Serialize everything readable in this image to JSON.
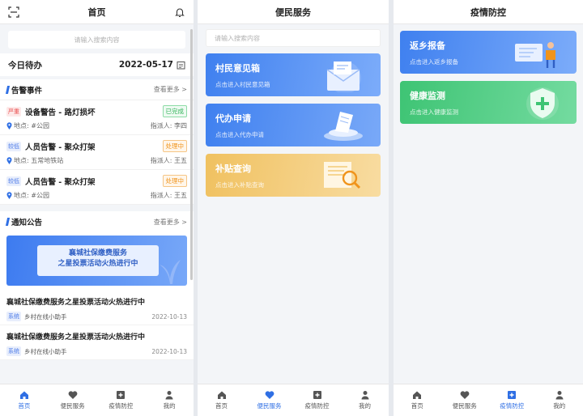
{
  "home": {
    "title": "首页",
    "search_placeholder": "请输入搜索内容",
    "todo_title": "今日待办",
    "todo_date": "2022-05-17",
    "alarm_section": {
      "title": "告警事件",
      "more": "查看更多 >"
    },
    "alarms": [
      {
        "level": "严重",
        "level_type": "high",
        "name": "设备警告 - 路灯损坏",
        "status": "已完成",
        "status_type": "done",
        "location": "地点: #公园",
        "assignee": "指派人: 李四"
      },
      {
        "level": "较低",
        "level_type": "low",
        "name": "人员告警 - 聚众打架",
        "status": "处理中",
        "status_type": "doing",
        "location": "地点: 五常地铁站",
        "assignee": "指派人: 王五"
      },
      {
        "level": "较低",
        "level_type": "low",
        "name": "人员告警 - 聚众打架",
        "status": "处理中",
        "status_type": "doing",
        "location": "地点: #公园",
        "assignee": "指派人: 王五"
      }
    ],
    "notice_section": {
      "title": "通知公告",
      "more": "查看更多 >"
    },
    "banner": {
      "line1": "襄城社保缴费服务",
      "line2": "之星投票活动火热进行中"
    },
    "news": [
      {
        "title": "襄城社保缴费服务之星投票活动火热进行中",
        "tag": "系统",
        "source": "乡村在线小助手",
        "date": "2022-10-13"
      },
      {
        "title": "襄城社保缴费服务之星投票活动火热进行中",
        "tag": "系统",
        "source": "乡村在线小助手",
        "date": "2022-10-13"
      }
    ]
  },
  "service": {
    "title": "便民服务",
    "search_placeholder": "请输入搜索内容",
    "cards": [
      {
        "title": "村民意见箱",
        "subtitle": "点击进入村民意见箱"
      },
      {
        "title": "代办申请",
        "subtitle": "点击进入代办申请"
      },
      {
        "title": "补贴查询",
        "subtitle": "点击进入补贴查询"
      }
    ]
  },
  "epidemic": {
    "title": "疫情防控",
    "cards": [
      {
        "title": "返乡报备",
        "subtitle": "点击进入返乡报备"
      },
      {
        "title": "健康监测",
        "subtitle": "点击进入健康监测"
      }
    ]
  },
  "tabbar": {
    "home": "首页",
    "service": "便民服务",
    "epidemic": "疫情防控",
    "mine": "我的"
  },
  "colors": {
    "accent": "#2f6fe4",
    "green": "#34b45b",
    "orange": "#f0941c",
    "red": "#e94b4b"
  }
}
